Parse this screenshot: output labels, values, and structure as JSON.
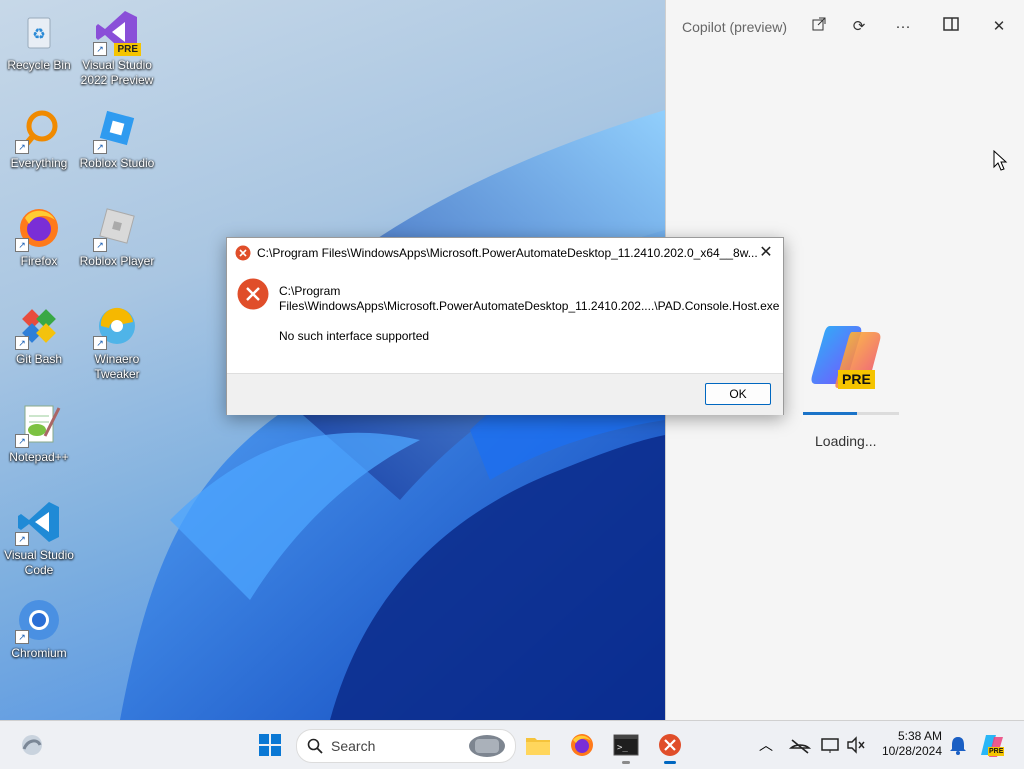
{
  "desktop_icons": [
    {
      "label": "Recycle Bin",
      "icon": "recycle-bin-icon"
    },
    {
      "label": "Visual Studio 2022 Preview",
      "icon": "visual-studio-icon",
      "badge": "PRE"
    },
    {
      "label": "Everything",
      "icon": "everything-icon"
    },
    {
      "label": "Roblox Studio",
      "icon": "roblox-studio-icon"
    },
    {
      "label": "Firefox",
      "icon": "firefox-icon"
    },
    {
      "label": "Roblox Player",
      "icon": "roblox-player-icon"
    },
    {
      "label": "Git Bash",
      "icon": "git-bash-icon"
    },
    {
      "label": "Winaero Tweaker",
      "icon": "winaero-tweaker-icon"
    },
    {
      "label": "Notepad++",
      "icon": "notepadpp-icon"
    },
    {
      "label": "Visual Studio Code",
      "icon": "vscode-icon"
    },
    {
      "label": "Chromium",
      "icon": "chromium-icon"
    }
  ],
  "copilot": {
    "title": "Copilot (preview)",
    "logo_badge": "PRE",
    "loading_text": "Loading..."
  },
  "dialog": {
    "title": "C:\\Program Files\\WindowsApps\\Microsoft.PowerAutomateDesktop_11.2410.202.0_x64__8w...",
    "path_line1": "C:\\Program",
    "path_line2": "Files\\WindowsApps\\Microsoft.PowerAutomateDesktop_11.2410.202....\\PAD.Console.Host.exe",
    "message": "No such interface supported",
    "ok_label": "OK"
  },
  "taskbar": {
    "search_placeholder": "Search",
    "time": "5:38 AM",
    "date": "10/28/2024",
    "tray_badge": "PRE"
  },
  "colors": {
    "accent": "#0067c0",
    "error_red": "#e04e2a",
    "copilot_panel": "#f5f5f5"
  }
}
